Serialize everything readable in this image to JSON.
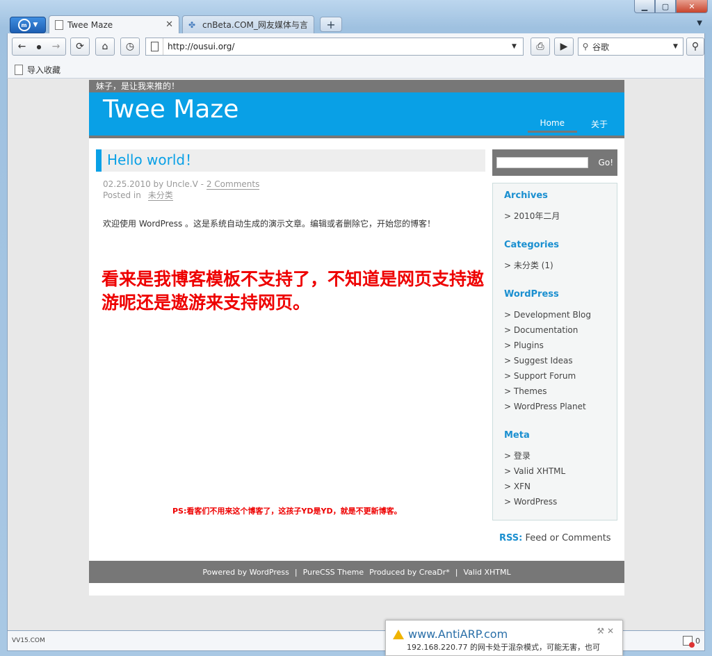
{
  "browser": {
    "tabs": [
      {
        "label": "Twee Maze",
        "active": true
      },
      {
        "label": "cnBeta.COM_网友媒体与言…",
        "active": false
      }
    ],
    "address": "http://ousui.org/",
    "search_engine": "谷歌",
    "bookmark": "导入收藏",
    "status_left": "VV15.COM",
    "status_count": "0"
  },
  "page": {
    "topline": "妹子，是让我来推的！",
    "site_title": "Twee Maze",
    "nav": [
      "Home",
      "关于"
    ],
    "post": {
      "title": "Hello world！",
      "date": "02.25.2010",
      "by": "by",
      "author": "Uncle.V",
      "dash": "-",
      "comments": "2 Comments",
      "posted_in": "Posted in",
      "category": "未分类",
      "body": "欢迎使用 WordPress 。这是系统自动生成的演示文章。编辑或者删除它，开始您的博客！"
    },
    "annotation": "看来是我博客模板不支持了，不知道是网页支持遨游呢还是遨游来支持网页。",
    "ps": "PS:看客们不用来这个博客了，这孩子YD是YD，就是不更新博客。",
    "sidebar": {
      "go": "Go!",
      "archives_title": "Archives",
      "archives": [
        "> 2010年二月"
      ],
      "categories_title": "Categories",
      "categories": [
        "> 未分类 (1)"
      ],
      "wordpress_title": "WordPress",
      "wordpress": [
        "> Development Blog",
        "> Documentation",
        "> Plugins",
        "> Suggest Ideas",
        "> Support Forum",
        "> Themes",
        "> WordPress Planet"
      ],
      "meta_title": "Meta",
      "meta": [
        "> 登录",
        "> Valid XHTML",
        "> XFN",
        "> WordPress"
      ],
      "rss_label": "RSS:",
      "rss_feed": "Feed",
      "rss_or": "or",
      "rss_comments": "Comments"
    },
    "footer": [
      "Powered by  WordPress",
      "|",
      "PureCSS Theme",
      "Produced by  CreaDr*",
      "|",
      "Valid XHTML"
    ]
  },
  "popup": {
    "title": "www.AntiARP.com",
    "body": "192.168.220.77 的网卡处于混杂模式，可能无害，也可"
  },
  "colors": {
    "header_blue": "#09a0e6",
    "accent_red": "#ee0000",
    "gray_bar": "#777777"
  }
}
